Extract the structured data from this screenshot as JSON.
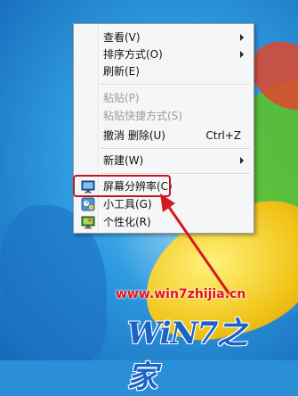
{
  "menu": {
    "items": [
      {
        "label": "查看(V)",
        "submenu": true
      },
      {
        "label": "排序方式(O)",
        "submenu": true
      },
      {
        "label": "刷新(E)"
      },
      {
        "label": "粘贴(P)",
        "disabled": true
      },
      {
        "label": "粘贴快捷方式(S)",
        "disabled": true
      },
      {
        "label": "撤消 删除(U)",
        "shortcut": "Ctrl+Z"
      },
      {
        "label": "新建(W)",
        "submenu": true
      },
      {
        "label": "屏幕分辨率(C)",
        "icon": "screen-resolution-icon"
      },
      {
        "label": "小工具(G)",
        "icon": "gadgets-icon"
      },
      {
        "label": "个性化(R)",
        "icon": "personalize-icon"
      }
    ]
  },
  "watermark": {
    "url": "www.win7zhijia.cn",
    "logo": "WiN7之家"
  },
  "colors": {
    "highlight": "#c8151b",
    "logo": "#1a63c8"
  }
}
